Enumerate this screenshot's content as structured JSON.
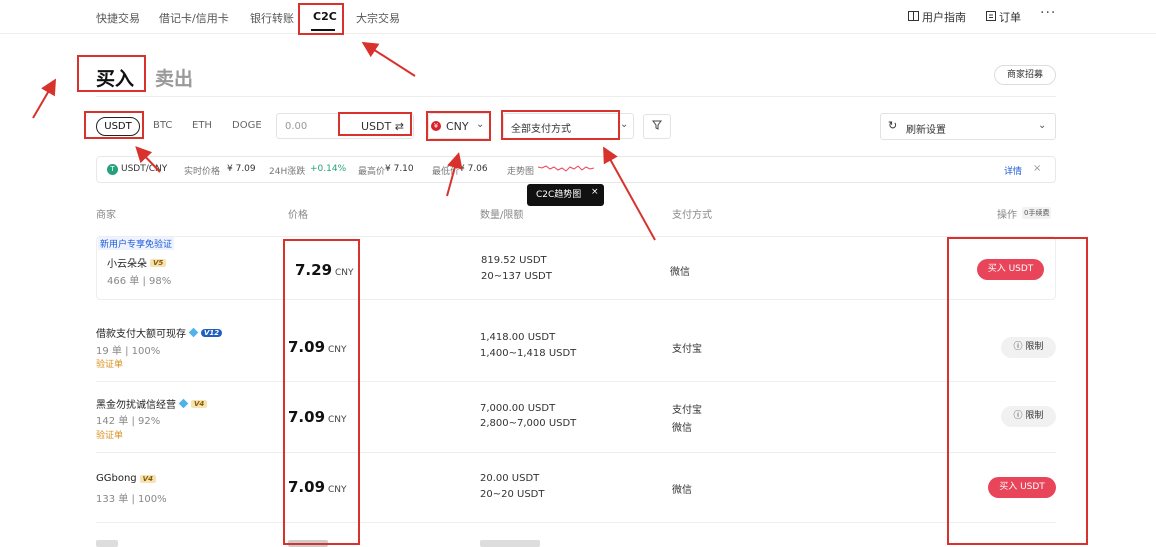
{
  "nav": {
    "items": [
      "快捷交易",
      "借记卡/信用卡",
      "银行转账",
      "C2C",
      "大宗交易"
    ],
    "guide": "用户指南",
    "orders": "订单",
    "more": "···"
  },
  "tabs": {
    "buy": "买入",
    "sell": "卖出"
  },
  "merchant_recruit": "商家招募",
  "filters": {
    "coins": [
      "USDT",
      "BTC",
      "ETH",
      "DOGE"
    ],
    "amount_placeholder": "0.00",
    "amount_unit": "USDT",
    "swap_icon": "⇄",
    "fiat": "CNY",
    "payment": "全部支付方式",
    "refresh": "刷新设置"
  },
  "market": {
    "pair": "USDT/CNY",
    "realtime_label": "实时价格",
    "realtime_value": "¥ 7.09",
    "change_label": "24H涨跌",
    "change_value": "+0.14%",
    "high_label": "最高价",
    "high_value": "¥ 7.10",
    "low_label": "最低价",
    "low_value": "¥ 7.06",
    "trend_label": "走势图",
    "detail": "详情",
    "tooltip": "C2C趋势图"
  },
  "table": {
    "headers": {
      "merchant": "商家",
      "price": "价格",
      "qty": "数量/限额",
      "pay": "支付方式",
      "action": "操作",
      "fee": "0手续费"
    },
    "new_user_tag": "新用户专享免验证",
    "rows": [
      {
        "name": "小云朵朵",
        "level": "V5",
        "stats": "466 单 | 98%",
        "verify": "",
        "price": "7.29",
        "unit": "CNY",
        "qty": "819.52 USDT",
        "limit": "20~137 USDT",
        "pay": [
          "微信"
        ],
        "action": "买入 USDT"
      },
      {
        "name": "借款支付大额可现存",
        "level": "V12",
        "stats": "19 单 | 100%",
        "verify": "验证单",
        "price": "7.09",
        "unit": "CNY",
        "qty": "1,418.00 USDT",
        "limit": "1,400~1,418 USDT",
        "pay": [
          "支付宝"
        ],
        "action": "限制"
      },
      {
        "name": "黑金勿扰诚信经营",
        "level": "V4",
        "stats": "142 单 | 92%",
        "verify": "验证单",
        "price": "7.09",
        "unit": "CNY",
        "qty": "7,000.00 USDT",
        "limit": "2,800~7,000 USDT",
        "pay": [
          "支付宝",
          "微信"
        ],
        "action": "限制"
      },
      {
        "name": "GGbong",
        "level": "V4",
        "stats": "133 单 | 100%",
        "verify": "",
        "price": "7.09",
        "unit": "CNY",
        "qty": "20.00 USDT",
        "limit": "20~20 USDT",
        "pay": [
          "微信"
        ],
        "action": "买入 USDT"
      }
    ]
  },
  "colors": {
    "accent_red": "#e8455a",
    "annotation_red": "#d8322c",
    "link_blue": "#1e5bd7"
  }
}
